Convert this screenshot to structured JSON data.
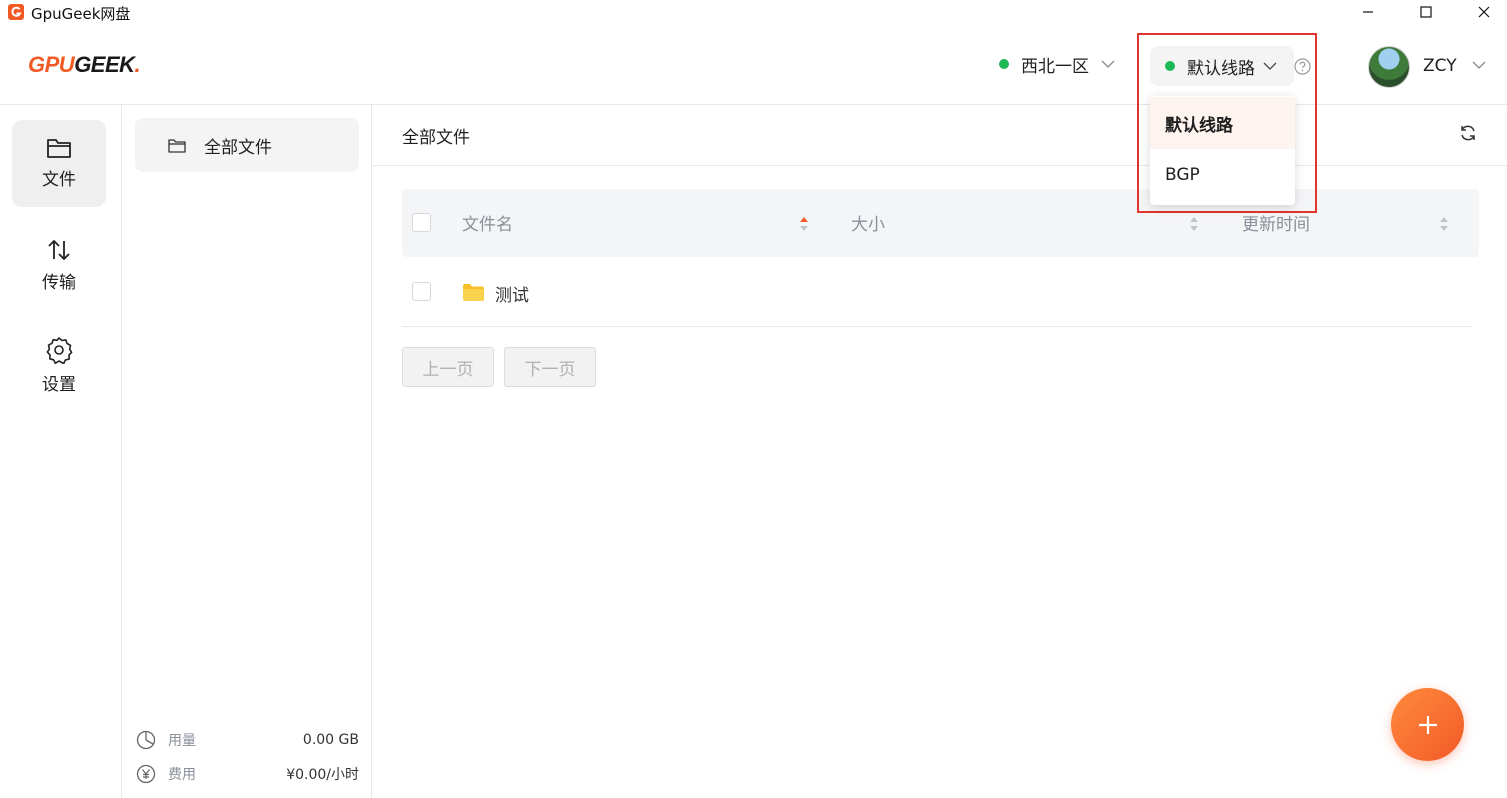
{
  "window": {
    "title": "GpuGeek网盘"
  },
  "header": {
    "logo_gpu": "GPU",
    "logo_geek": "GEEK",
    "logo_dot": ".",
    "region": "西北一区",
    "line": "默认线路",
    "user_name": "ZCY"
  },
  "line_dropdown": {
    "options": [
      {
        "label": "默认线路",
        "selected": true
      },
      {
        "label": "BGP",
        "selected": false
      }
    ]
  },
  "rail": {
    "items": [
      {
        "label": "文件",
        "icon": "folder-icon",
        "active": true
      },
      {
        "label": "传输",
        "icon": "transfer-arrows-icon",
        "active": false
      },
      {
        "label": "设置",
        "icon": "gear-icon",
        "active": false
      }
    ]
  },
  "sidebar": {
    "all_files": "全部文件",
    "usage_label": "用量",
    "usage_value": "0.00 GB",
    "cost_label": "费用",
    "cost_value": "¥0.00/小时"
  },
  "main": {
    "breadcrumb": "全部文件",
    "columns": {
      "name": "文件名",
      "size": "大小",
      "updated": "更新时间"
    },
    "rows": [
      {
        "name": "测试",
        "type": "folder"
      }
    ],
    "pager": {
      "prev": "上一页",
      "next": "下一页"
    }
  },
  "colors": {
    "brand": "#f15a24",
    "highlight": "#e0342f",
    "status_green": "#1db954",
    "folder": "#f8c12c"
  }
}
